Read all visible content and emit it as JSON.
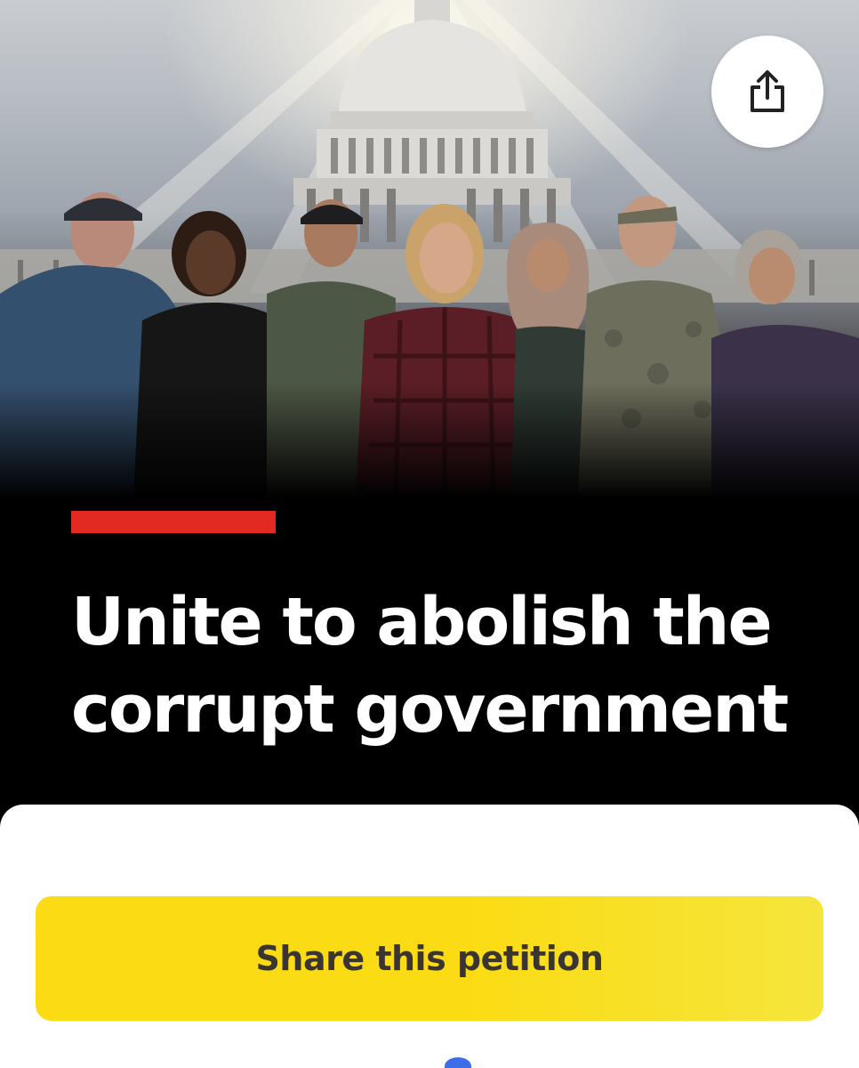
{
  "hero": {
    "image_alt": "People standing together in front of the U.S. Capitol dome",
    "share_icon": "share-icon"
  },
  "petition": {
    "title": "Unite to abolish the corrupt government",
    "accent_color": "#e32a22"
  },
  "actions": {
    "share_label": "Share this petition",
    "share_button_color": "#fbdc14"
  }
}
